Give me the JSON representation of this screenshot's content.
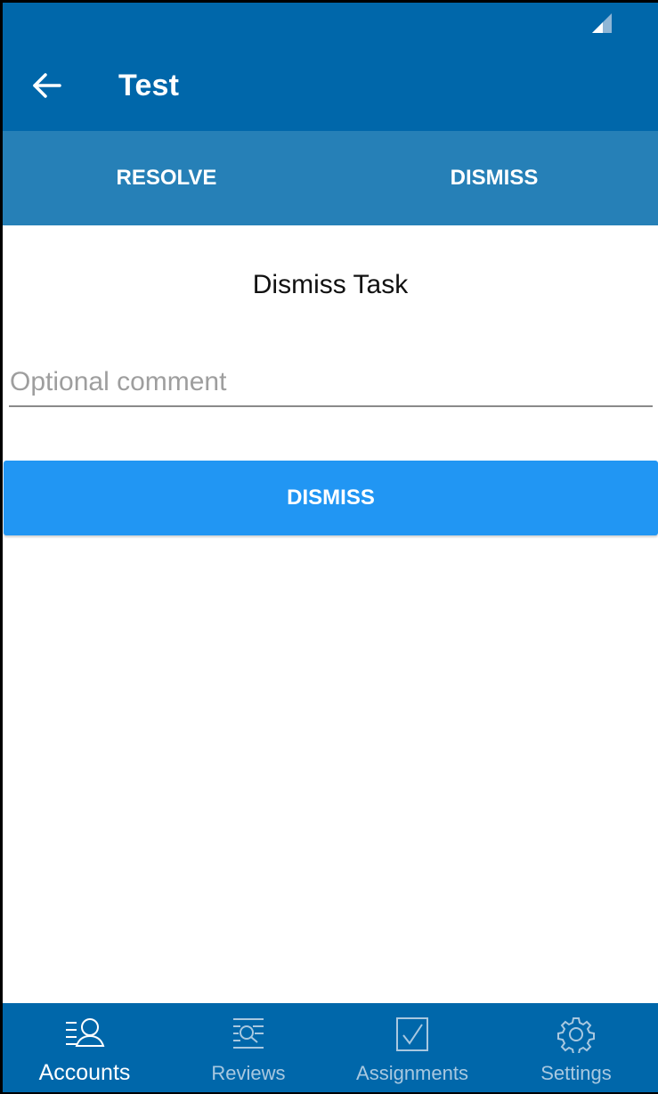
{
  "app_bar": {
    "title": "Test",
    "back_icon": "arrow-left-icon"
  },
  "tabs": [
    {
      "label": "RESOLVE"
    },
    {
      "label": "DISMISS"
    }
  ],
  "dialog": {
    "title": "Dismiss Task",
    "comment_placeholder": "Optional comment",
    "comment_value": "",
    "submit_label": "DISMISS"
  },
  "bottom_nav": {
    "items": [
      {
        "label": "Accounts",
        "icon": "accounts-icon",
        "active": true
      },
      {
        "label": "Reviews",
        "icon": "reviews-icon",
        "active": false
      },
      {
        "label": "Assignments",
        "icon": "assignments-icon",
        "active": false
      },
      {
        "label": "Settings",
        "icon": "settings-icon",
        "active": false
      }
    ]
  },
  "colors": {
    "primary": "#0067aa",
    "tab_bar": "#2680b7",
    "button": "#2196f3",
    "inactive_nav": "#a8c8e0"
  }
}
